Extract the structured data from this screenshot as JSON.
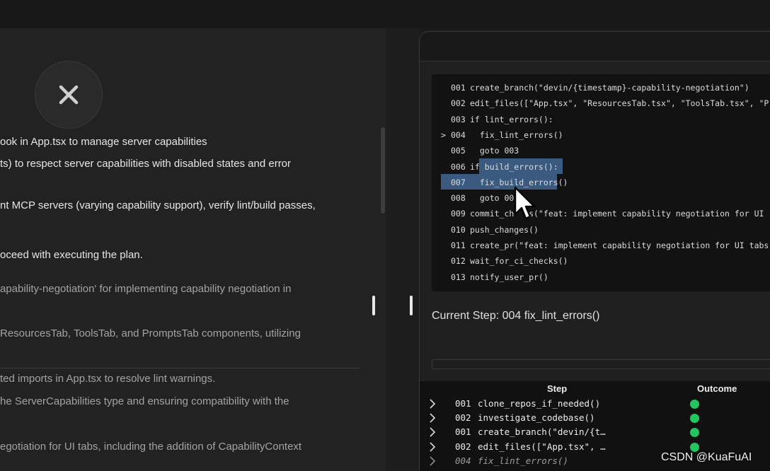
{
  "chat": {
    "lines": [
      "ook in App.tsx to manage server capabilities",
      "ts) to respect server capabilities with disabled states and error",
      "nt MCP servers (varying capability support), verify lint/build passes,",
      "oceed with executing the plan.",
      "apability-negotiation' for implementing capability negotiation in",
      "ResourcesTab, ToolsTab, and PromptsTab components, utilizing",
      "ted imports in App.tsx to resolve lint warnings.",
      "he ServerCapabilities type and ensuring compatibility with the",
      "egotiation for UI tabs, including the addition of CapabilityContext"
    ]
  },
  "plan": {
    "lines": [
      {
        "num": "001",
        "code": "create_branch(\"devin/{timestamp}-capability-negotiation\")",
        "marker": ""
      },
      {
        "num": "002",
        "code": "edit_files([\"App.tsx\", \"ResourcesTab.tsx\", \"ToolsTab.tsx\", \"Pr",
        "marker": ""
      },
      {
        "num": "003",
        "code": "if lint_errors():",
        "marker": ""
      },
      {
        "num": "004",
        "code": "  fix_lint_errors()",
        "marker": ">"
      },
      {
        "num": "005",
        "code": "  goto 003",
        "marker": ""
      },
      {
        "num": "006",
        "code": "if build_errors():",
        "marker": ""
      },
      {
        "num": "007",
        "code": "  fix_build_errors()",
        "marker": ""
      },
      {
        "num": "008",
        "code": "  goto 00",
        "marker": ""
      },
      {
        "num": "009",
        "code": "commit_ch   s(\"feat: implement capability negotiation for UI",
        "marker": ""
      },
      {
        "num": "010",
        "code": "push_changes()",
        "marker": ""
      },
      {
        "num": "011",
        "code": "create_pr(\"feat: implement capability negotiation for UI tabs\"",
        "marker": ""
      },
      {
        "num": "012",
        "code": "wait_for_ci_checks()",
        "marker": ""
      },
      {
        "num": "013",
        "code": "notify_user_pr()",
        "marker": ""
      }
    ]
  },
  "current_step": "Current Step: 004 fix_lint_errors()",
  "steps_table": {
    "headers": {
      "step": "Step",
      "outcome": "Outcome"
    },
    "rows": [
      {
        "num": "001",
        "code": "clone_repos_if_needed()",
        "outcome": "success",
        "italic": false
      },
      {
        "num": "002",
        "code": "investigate_codebase()",
        "outcome": "success",
        "italic": false
      },
      {
        "num": "001",
        "code": "create_branch(\"devin/{t…",
        "outcome": "success",
        "italic": false
      },
      {
        "num": "002",
        "code": "edit_files([\"App.tsx\", …",
        "outcome": "success",
        "italic": false
      },
      {
        "num": "004",
        "code": "fix_lint_errors()",
        "outcome": "",
        "italic": true
      }
    ]
  },
  "icons": {
    "close": "close-icon",
    "cursor": "mouse-pointer-icon",
    "chevron": "chevron-right-icon"
  },
  "colors": {
    "selection": "#3a5a80",
    "success": "#22c55e"
  },
  "watermark": "CSDN @KuaFuAI"
}
